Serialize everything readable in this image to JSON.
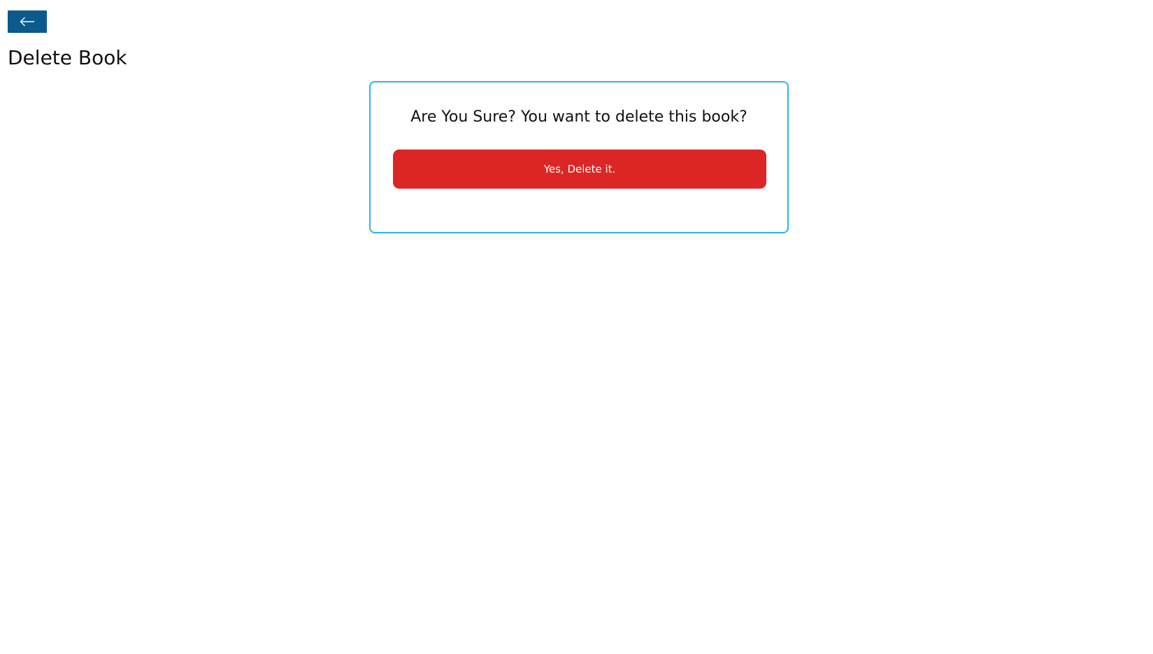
{
  "header": {
    "back_icon": "arrow-left-icon",
    "title": "Delete Book"
  },
  "dialog": {
    "message": "Are You Sure? You want to delete this book?",
    "confirm_label": "Yes, Delete it."
  },
  "colors": {
    "back_button": "#0b5a8c",
    "card_border": "#29b6e8",
    "danger": "#dc2626"
  }
}
